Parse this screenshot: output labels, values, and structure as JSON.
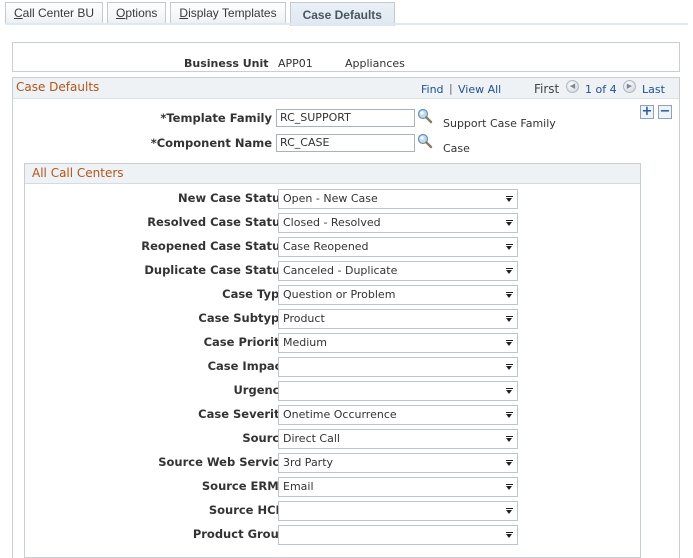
{
  "tabs": [
    {
      "accesskey": "C",
      "rest": "all Center BU",
      "active": false
    },
    {
      "accesskey": "O",
      "rest": "ptions",
      "active": false
    },
    {
      "accesskey": "D",
      "rest": "isplay Templates",
      "active": false
    },
    {
      "label": "Case Defaults",
      "active": true
    }
  ],
  "business_unit": {
    "label": "Business Unit",
    "value": "APP01",
    "description": "Appliances"
  },
  "case_defaults": {
    "title": "Case Defaults",
    "nav": {
      "find": "Find",
      "separator": "|",
      "view_all": "View All",
      "first": "First",
      "position": "1 of 4",
      "last": "Last"
    },
    "add_row": "+",
    "delete_row": "−",
    "template_family": {
      "label": "*Template Family",
      "value": "RC_SUPPORT",
      "description": "Support Case Family"
    },
    "component_name": {
      "label": "*Component Name",
      "value": "RC_CASE",
      "description": "Case"
    }
  },
  "all_call_centers": {
    "title": "All Call Centers",
    "fields": [
      {
        "label": "New Case Status",
        "value": "Open - New Case"
      },
      {
        "label": "Resolved Case Status",
        "value": "Closed - Resolved"
      },
      {
        "label": "Reopened Case Status",
        "value": "Case Reopened"
      },
      {
        "label": "Duplicate Case Status",
        "value": "Canceled - Duplicate"
      },
      {
        "label": "Case Type",
        "value": "Question or Problem"
      },
      {
        "label": "Case Subtype",
        "value": "Product"
      },
      {
        "label": "Case Priority",
        "value": "Medium"
      },
      {
        "label": "Case Impact",
        "value": ""
      },
      {
        "label": "Urgency",
        "value": ""
      },
      {
        "label": "Case Severity",
        "value": "Onetime Occurrence"
      },
      {
        "label": "Source",
        "value": "Direct Call"
      },
      {
        "label": "Source Web Service",
        "value": "3rd Party"
      },
      {
        "label": "Source ERMS",
        "value": "Email"
      },
      {
        "label": "Source HCM",
        "value": ""
      },
      {
        "label": "Product Group",
        "value": ""
      }
    ]
  },
  "colors": {
    "section_title": "#b0561a",
    "link": "#1f4f99"
  }
}
